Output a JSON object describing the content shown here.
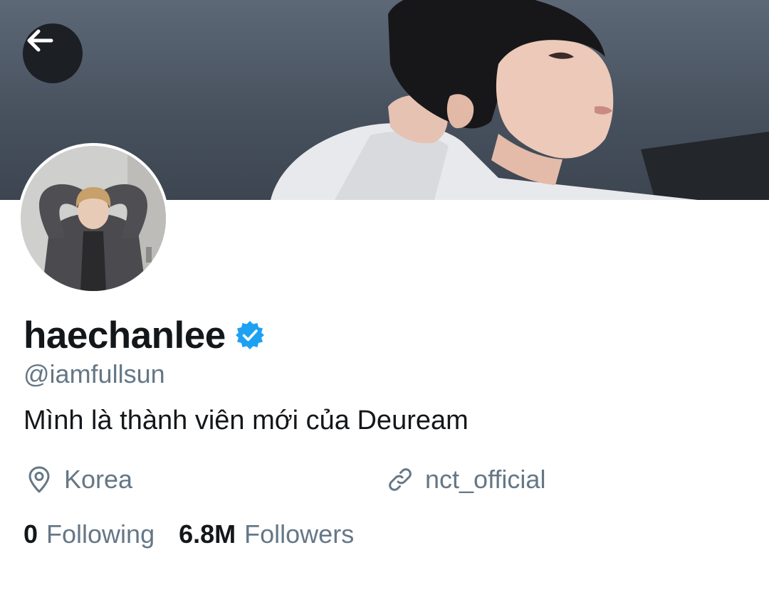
{
  "profile": {
    "display_name": "haechanlee",
    "handle": "@iamfullsun",
    "bio": "Mình là thành viên mới của Deuream",
    "location": "Korea",
    "website": "nct_official",
    "verified": true
  },
  "stats": {
    "following_count": "0",
    "following_label": "Following",
    "followers_count": "6.8M",
    "followers_label": "Followers"
  },
  "icons": {
    "back": "arrow-left-icon",
    "verified": "verified-badge-icon",
    "location": "location-pin-icon",
    "link": "link-icon"
  },
  "colors": {
    "text_primary": "#14171a",
    "text_secondary": "#657786",
    "verified_blue": "#1da1f2",
    "back_button_bg": "#1c1f23"
  }
}
